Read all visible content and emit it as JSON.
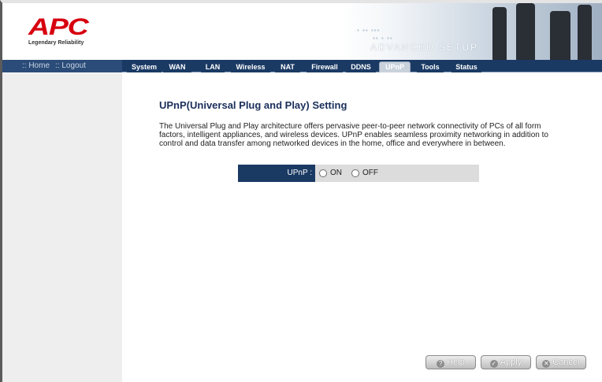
{
  "brand": {
    "logo": "APC",
    "tagline": "Legendary Reliability",
    "section": "ADVANCED SETUP"
  },
  "nav": {
    "home": ":: Home",
    "logout": ":: Logout",
    "tabs": [
      "System",
      "WAN",
      "LAN",
      "Wireless",
      "NAT",
      "Firewall",
      "DDNS",
      "UPnP",
      "Tools",
      "Status"
    ],
    "active_tab": "UPnP"
  },
  "page": {
    "title": "UPnP(Universal Plug and Play) Setting",
    "description": "The Universal Plug and Play architecture offers pervasive peer-to-peer network connectivity of PCs of all form factors, intelligent appliances, and wireless devices. UPnP enables seamless proximity networking in addition to control and data transfer among networked devices in the home, office and everywhere in between."
  },
  "upnp": {
    "label": "UPnP :",
    "on_label": "ON",
    "off_label": "OFF"
  },
  "buttons": {
    "help": "Help",
    "apply": "Apply",
    "cancel": "Cancel"
  },
  "colors": {
    "nav_dark": "#1a3a64",
    "title": "#1a2f5a",
    "brand_red": "#d7000f"
  },
  "icons": {
    "help": "help-icon",
    "apply": "apply-icon",
    "cancel": "cancel-icon"
  }
}
